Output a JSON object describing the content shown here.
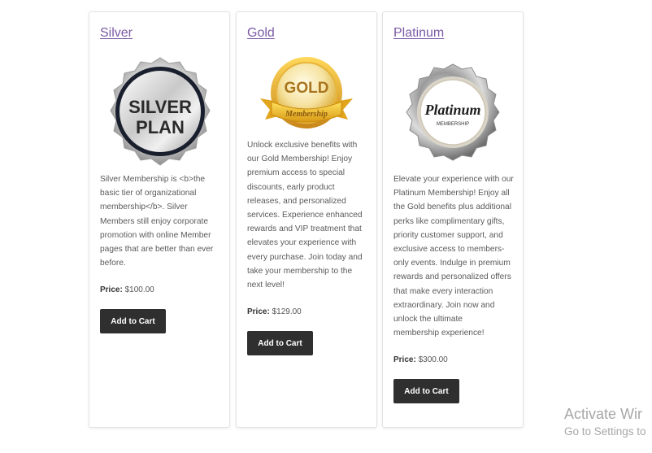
{
  "plans": [
    {
      "title": "Silver",
      "badge_text_line1": "SILVER",
      "badge_text_line2": "PLAN",
      "description": "Silver Membership is <b>the\nbasic tier of organizational\nmembership</b>. Silver\nMembers still enjoy corporate\npromotion with online Member\npages that are better than ever\nbefore.",
      "price_label": "Price:",
      "price_value": "$100.00",
      "button_label": "Add to Cart",
      "badge_icon": "silver-seal-icon"
    },
    {
      "title": "Gold",
      "badge_text_line1": "GOLD",
      "badge_text_line2": "Membership",
      "description": "Unlock exclusive benefits with\nour Gold Membership! Enjoy\npremium access to special\ndiscounts, early product\nreleases, and personalized\nservices. Experience enhanced\nrewards and VIP treatment that\nelevates your experience with\nevery purchase. Join today and\ntake your membership to the\nnext level!",
      "price_label": "Price:",
      "price_value": "$129.00",
      "button_label": "Add to Cart",
      "badge_icon": "gold-medal-icon"
    },
    {
      "title": "Platinum",
      "badge_text_line1": "Platinum",
      "badge_text_line2": "MEMBERSHIP",
      "description": "Elevate your experience with our\nPlatinum Membership! Enjoy all\nthe Gold benefits plus additional\nperks like complimentary gifts,\npriority customer support, and\nexclusive access to members-\nonly events. Indulge in premium\nrewards and personalized offers\nthat make every interaction\nextraordinary. Join now and\nunlock the ultimate\nmembership experience!",
      "price_label": "Price:",
      "price_value": "$300.00",
      "button_label": "Add to Cart",
      "badge_icon": "platinum-seal-icon"
    }
  ],
  "watermark": {
    "title": "Activate Wir",
    "subtitle": "Go to Settings to"
  },
  "colors": {
    "link": "#7b5aa6",
    "button_bg": "#2f2f2f",
    "button_text": "#ffffff"
  }
}
